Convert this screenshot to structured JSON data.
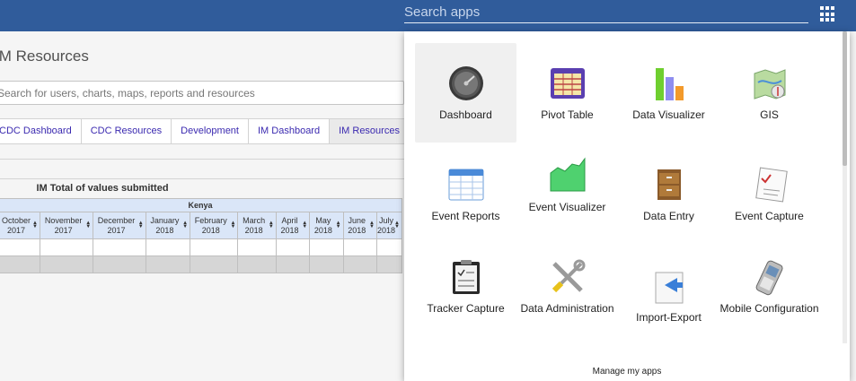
{
  "header": {
    "search_placeholder": "Search apps"
  },
  "dashboard": {
    "title": "IM Resources",
    "filter_placeholder": "Search for users, charts, maps, reports and resources",
    "tabs": [
      "CDC Dashboard",
      "CDC Resources",
      "Development",
      "IM Dashboard",
      "IM Resources"
    ],
    "active_tab": "IM Resources",
    "item_title": "IM Total of values submitted",
    "table": {
      "group_header": "Kenya",
      "columns": [
        {
          "month": "October",
          "year": "2017"
        },
        {
          "month": "November",
          "year": "2017"
        },
        {
          "month": "December",
          "year": "2017"
        },
        {
          "month": "January",
          "year": "2018"
        },
        {
          "month": "February",
          "year": "2018"
        },
        {
          "month": "March",
          "year": "2018"
        },
        {
          "month": "April",
          "year": "2018"
        },
        {
          "month": "May",
          "year": "2018"
        },
        {
          "month": "June",
          "year": "2018"
        },
        {
          "month": "July",
          "year": "2018"
        }
      ]
    }
  },
  "apps_menu": {
    "apps": [
      {
        "label": "Dashboard",
        "icon": "dashboard-icon"
      },
      {
        "label": "Pivot Table",
        "icon": "pivot-table-icon"
      },
      {
        "label": "Data Visualizer",
        "icon": "data-visualizer-icon"
      },
      {
        "label": "GIS",
        "icon": "gis-icon"
      },
      {
        "label": "Event Reports",
        "icon": "event-reports-icon"
      },
      {
        "label": "Event Visualizer",
        "icon": "event-visualizer-icon"
      },
      {
        "label": "Data Entry",
        "icon": "data-entry-icon"
      },
      {
        "label": "Event Capture",
        "icon": "event-capture-icon"
      },
      {
        "label": "Tracker Capture",
        "icon": "tracker-capture-icon"
      },
      {
        "label": "Data Administration",
        "icon": "data-administration-icon"
      },
      {
        "label": "Import-Export",
        "icon": "import-export-icon"
      },
      {
        "label": "Mobile Configuration",
        "icon": "mobile-configuration-icon"
      }
    ],
    "manage_label": "Manage my apps"
  },
  "colors": {
    "header_bg": "#305c9b",
    "tab_text": "#3b2ab0",
    "table_header_bg": "#dae6f8"
  }
}
